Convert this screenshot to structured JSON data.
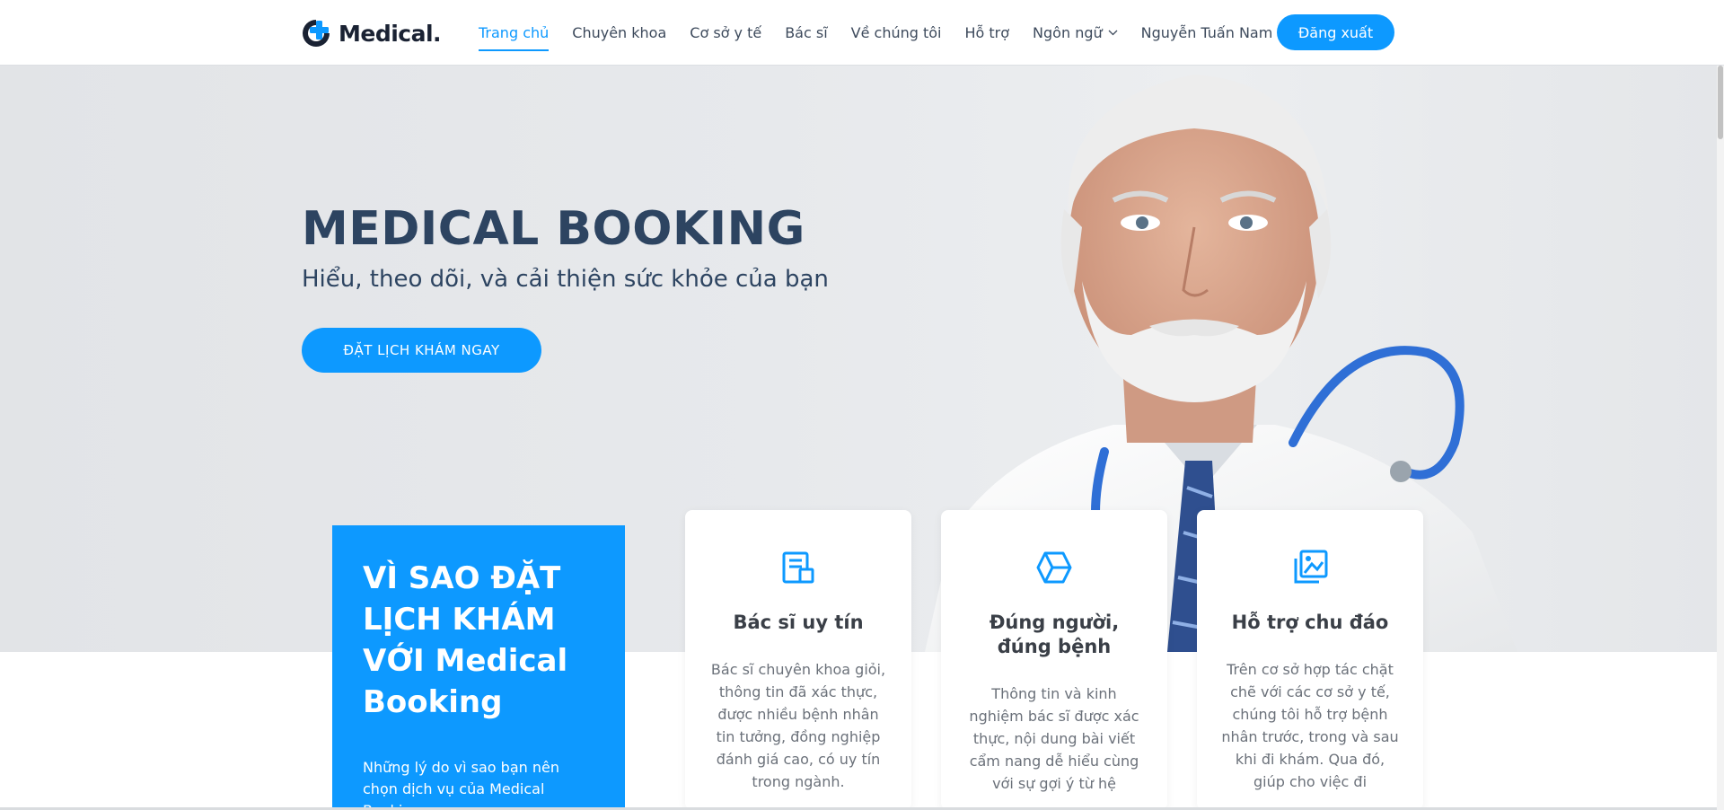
{
  "header": {
    "logo_text": "Medical.",
    "nav": [
      {
        "label": "Trang chủ",
        "active": true
      },
      {
        "label": "Chuyên khoa"
      },
      {
        "label": "Cơ sở y tế"
      },
      {
        "label": "Bác sĩ"
      },
      {
        "label": "Về chúng tôi"
      },
      {
        "label": "Hỗ trợ"
      },
      {
        "label": "Ngôn ngữ",
        "dropdown": true
      },
      {
        "label": "Nguyễn Tuấn Nam",
        "dropdown": true
      }
    ],
    "logout_label": "Đăng xuất"
  },
  "hero": {
    "title": "MEDICAL BOOKING",
    "subtitle": "Hiểu, theo dõi, và cải thiện sức khỏe của bạn",
    "cta_label": "ĐẶT LỊCH KHÁM NGAY"
  },
  "why": {
    "title": "VÌ SAO ĐẶT LỊCH KHÁM VỚI Medical Booking",
    "description": "Những lý do vì sao bạn nên chọn dịch vụ của Medical Booking"
  },
  "features": [
    {
      "icon": "document-icon",
      "title": "Bác sĩ uy tín",
      "text": "Bác sĩ chuyên khoa giỏi, thông tin đã xác thực, được nhiều bệnh nhân tin tưởng, đồng nghiệp đánh giá cao, có uy tín trong ngành."
    },
    {
      "icon": "hexagon-icon",
      "title": "Đúng người, đúng bệnh",
      "text": "Thông tin và kinh nghiệm bác sĩ được xác thực, nội dung bài viết cẩm nang dễ hiểu cùng với sự gợi ý từ hệ"
    },
    {
      "icon": "gallery-icon",
      "title": "Hỗ trợ chu đáo",
      "text": "Trên cơ sở hợp tác chặt chẽ với các cơ sở y tế, chúng tôi hỗ trợ bệnh nhân trước, trong và sau khi đi khám. Qua đó, giúp cho việc đi"
    }
  ],
  "colors": {
    "accent": "#0d99ff",
    "heading": "#2d4461",
    "nav_text": "#3d4a5c"
  }
}
